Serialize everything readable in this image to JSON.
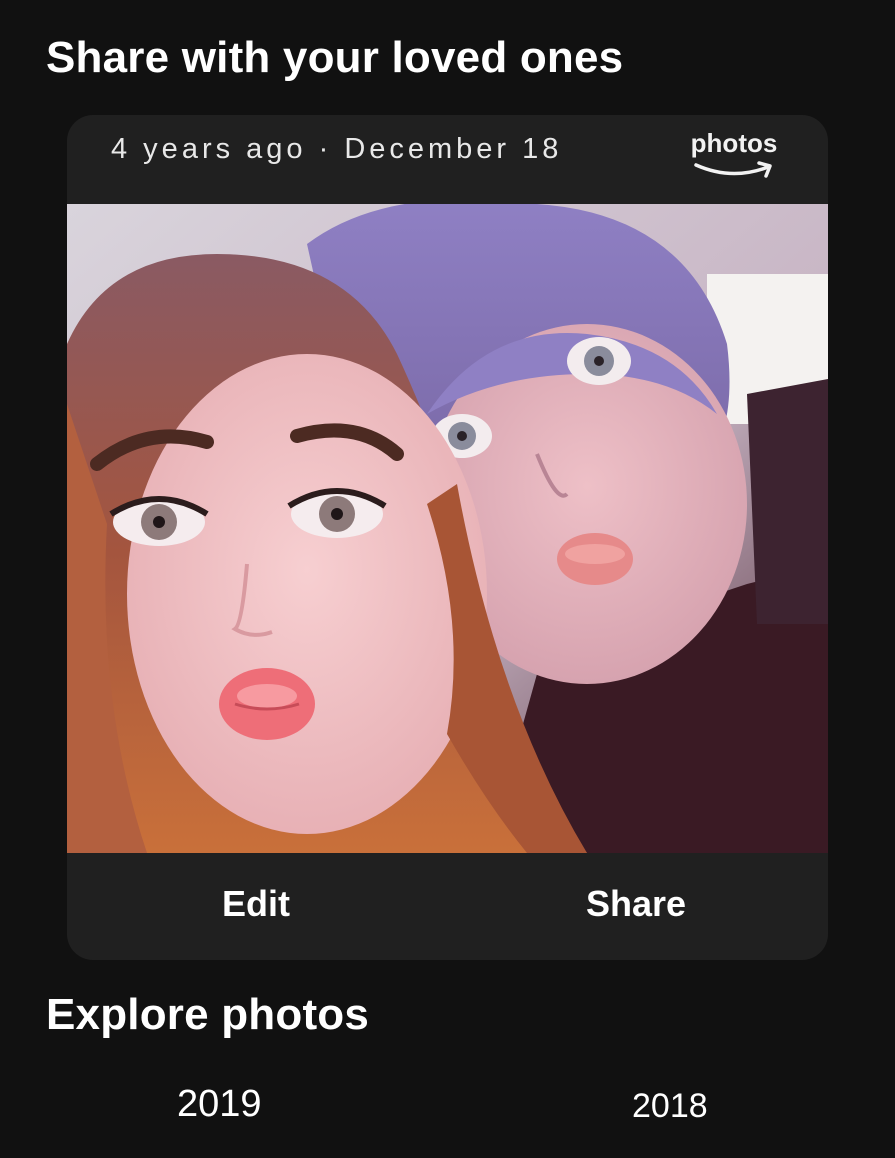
{
  "section_share": {
    "title": "Share with your loved ones"
  },
  "memory_card": {
    "date_text": "4 years ago · December 18",
    "brand": {
      "text": "photos",
      "icon": "amazon-smile-arrow-icon"
    },
    "photo": {
      "icon": "selfie-photo"
    },
    "actions": {
      "edit_label": "Edit",
      "share_label": "Share"
    }
  },
  "section_explore": {
    "title": "Explore photos",
    "years": [
      "2019",
      "2018"
    ]
  },
  "colors": {
    "background": "#111111",
    "card": "#202020",
    "text": "#ffffff"
  }
}
